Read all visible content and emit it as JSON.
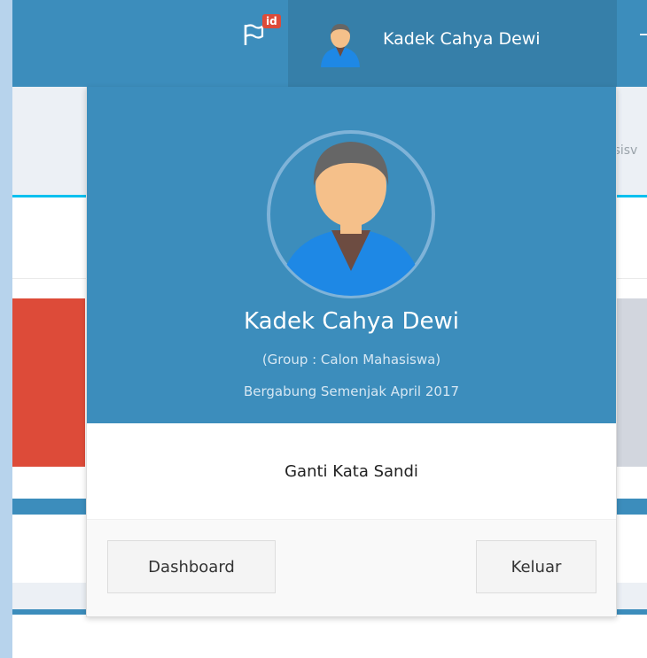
{
  "navbar": {
    "language_badge": "id",
    "user_name": "Kadek Cahya Dewi"
  },
  "background": {
    "tab_partial_text": "asisv"
  },
  "dropdown": {
    "name": "Kadek Cahya Dewi",
    "group": "(Group : Calon Mahasiswa)",
    "member_since": "Bergabung Semenjak April 2017",
    "change_password": "Ganti Kata Sandi",
    "dashboard_label": "Dashboard",
    "logout_label": "Keluar"
  },
  "colors": {
    "navbar": "#3c8dbc",
    "navbar_active": "#367fa9",
    "badge": "#dd4b39",
    "tab_accent": "#00c0ef"
  },
  "icons": {
    "flag": "flag-icon",
    "avatar": "user-avatar-icon"
  }
}
